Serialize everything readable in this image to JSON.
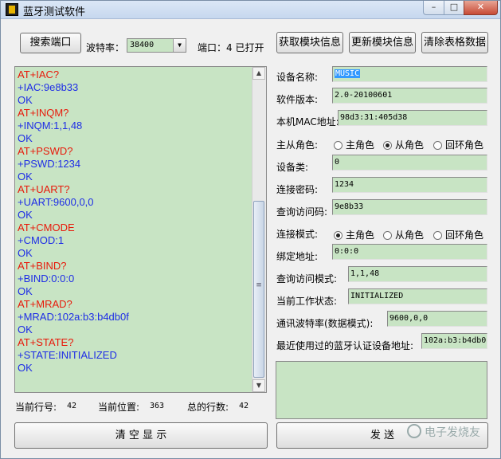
{
  "window": {
    "title": "蓝牙测试软件",
    "controls": {
      "minimize": "–",
      "maximize": "□",
      "close": "✕"
    }
  },
  "toolbar": {
    "search_port_button": "搜索端口",
    "baud_label": "波特率：",
    "baud_value": "38400",
    "port_status": "端口：4 已打开",
    "get_info_button": "获取模块信息",
    "update_info_button": "更新模块信息",
    "clear_table_button": "清除表格数据"
  },
  "log": {
    "lines": [
      {
        "text": "AT+IAC?",
        "kind": "cmd"
      },
      {
        "text": "+IAC:9e8b33",
        "kind": "resp"
      },
      {
        "text": "OK",
        "kind": "resp"
      },
      {
        "text": "AT+INQM?",
        "kind": "cmd"
      },
      {
        "text": "+INQM:1,1,48",
        "kind": "resp"
      },
      {
        "text": "OK",
        "kind": "resp"
      },
      {
        "text": "AT+PSWD?",
        "kind": "cmd"
      },
      {
        "text": "+PSWD:1234",
        "kind": "resp"
      },
      {
        "text": "OK",
        "kind": "resp"
      },
      {
        "text": "AT+UART?",
        "kind": "cmd"
      },
      {
        "text": "+UART:9600,0,0",
        "kind": "resp"
      },
      {
        "text": "OK",
        "kind": "resp"
      },
      {
        "text": "AT+CMODE",
        "kind": "cmd"
      },
      {
        "text": "+CMOD:1",
        "kind": "resp"
      },
      {
        "text": "OK",
        "kind": "resp"
      },
      {
        "text": "AT+BIND?",
        "kind": "cmd"
      },
      {
        "text": "+BIND:0:0:0",
        "kind": "resp"
      },
      {
        "text": "OK",
        "kind": "resp"
      },
      {
        "text": "AT+MRAD?",
        "kind": "cmd"
      },
      {
        "text": "+MRAD:102a:b3:b4db0f",
        "kind": "resp"
      },
      {
        "text": "OK",
        "kind": "resp"
      },
      {
        "text": "AT+STATE?",
        "kind": "cmd"
      },
      {
        "text": "+STATE:INITIALIZED",
        "kind": "resp"
      },
      {
        "text": "OK",
        "kind": "resp"
      }
    ],
    "scroll_up": "▲",
    "scroll_down": "▼",
    "thumb_grip": "≡"
  },
  "status": {
    "current_line_label": "当前行号:",
    "current_line_value": "42",
    "current_pos_label": "当前位置:",
    "current_pos_value": "363",
    "total_lines_label": "总的行数:",
    "total_lines_value": "42"
  },
  "actions": {
    "clear_display_button": "清 空 显 示",
    "send_button": "发 送"
  },
  "info": {
    "device_name_label": "设备名称:",
    "device_name_value": "MUSIC",
    "software_version_label": "软件版本:",
    "software_version_value": "2.0-20100601",
    "mac_label": "本机MAC地址:",
    "mac_value": "98d3:31:405d38",
    "role_label": "主从角色:",
    "role_options": [
      "主角色",
      "从角色",
      "回环角色"
    ],
    "role_selected": 1,
    "device_class_label": "设备类:",
    "device_class_value": "0",
    "pin_label": "连接密码:",
    "pin_value": "1234",
    "inquiry_code_label": "查询访问码:",
    "inquiry_code_value": "9e8b33",
    "conn_mode_label": "连接模式:",
    "conn_mode_options": [
      "主角色",
      "从角色",
      "回环角色"
    ],
    "conn_mode_selected": 0,
    "bind_label": "绑定地址:",
    "bind_value": "0:0:0",
    "inq_mode_label": "查询访问模式:",
    "inq_mode_value": "1,1,48",
    "state_label": "当前工作状态:",
    "state_value": "INITIALIZED",
    "uart_label": "通讯波特率(数据模式):",
    "uart_value": "9600,0,0",
    "recent_label": "最近使用过的蓝牙认证设备地址:",
    "recent_value": "102a:b3:b4db0"
  },
  "watermark": "电子发烧友"
}
